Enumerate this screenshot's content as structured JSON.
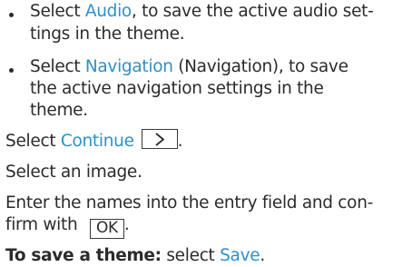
{
  "bullets": [
    {
      "lines": [
        {
          "pre": "Select ",
          "term": "Audio",
          "post": ", to save the active audio set-"
        },
        {
          "text": "tings in the theme."
        }
      ]
    },
    {
      "lines": [
        {
          "pre": "Select ",
          "term": "Navigation",
          "post": " (Navigation), to save"
        },
        {
          "text": "the active navigation settings in the"
        },
        {
          "text": "theme."
        }
      ]
    }
  ],
  "step_continue": {
    "pre": "Select ",
    "term": "Continue",
    "key_icon": "chevron-right-icon",
    "post": "."
  },
  "step_image": "Select an image.",
  "step_names": {
    "line1": "Enter the names into the entry field and con-",
    "line2_pre": "firm with ",
    "key_label": "OK",
    "line2_post": "."
  },
  "save_theme": {
    "bold_label": "To save a theme:",
    "pre": " select ",
    "term": "Save",
    "post": "."
  },
  "colors": {
    "text": "#2b2b2b",
    "menu_term": "#2e90c8"
  }
}
